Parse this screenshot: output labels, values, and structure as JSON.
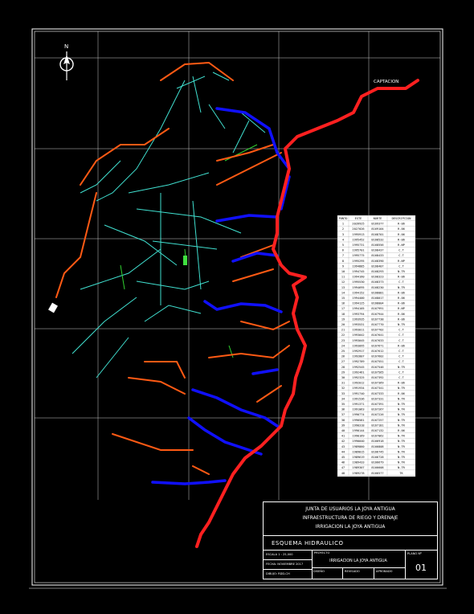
{
  "north_label": "N",
  "captacion_label": "CAPTACION",
  "table": {
    "headers": [
      "PUNTO",
      "ESTE",
      "NORTE",
      "DESCRIPCION"
    ],
    "rows": [
      [
        "1",
        "2026925",
        "8169377",
        "R-06"
      ],
      [
        "2",
        "2027026",
        "8169104",
        "R-06"
      ],
      [
        "3",
        "1995913",
        "8168701",
        "R-06"
      ],
      [
        "4",
        "1995452",
        "8168532",
        "R-06"
      ],
      [
        "5",
        "1995731",
        "8168556",
        "R-NP"
      ],
      [
        "6",
        "1995701",
        "8168437",
        "C.T"
      ],
      [
        "7",
        "1995775",
        "8168433",
        "C.T"
      ],
      [
        "8",
        "1995295",
        "8168390",
        "R-NP"
      ],
      [
        "9",
        "1994885",
        "8168407",
        "C.T"
      ],
      [
        "10",
        "1994745",
        "8168293",
        "N.TR"
      ],
      [
        "11",
        "1994160",
        "8168323",
        "R-06"
      ],
      [
        "12",
        "1995530",
        "8168373",
        "C.T"
      ],
      [
        "13",
        "1994695",
        "8168230",
        "N.TR"
      ],
      [
        "14",
        "1994152",
        "8168081",
        "R-06"
      ],
      [
        "15",
        "1994400",
        "8168017",
        "R-06"
      ],
      [
        "16",
        "1994125",
        "8168004",
        "R-06"
      ],
      [
        "17",
        "1994105",
        "8167991",
        "R-NP"
      ],
      [
        "18",
        "1993794",
        "8167944",
        "R-06"
      ],
      [
        "19",
        "1993935",
        "8167738",
        "R-06"
      ],
      [
        "20",
        "1993531",
        "8167770",
        "N.TR"
      ],
      [
        "21",
        "1993011",
        "8167702",
        "C.T"
      ],
      [
        "22",
        "1993042",
        "8167641",
        "C.T"
      ],
      [
        "23",
        "1993045",
        "8167633",
        "C.T"
      ],
      [
        "24",
        "1993095",
        "8167671",
        "R-06"
      ],
      [
        "25",
        "1992917",
        "8167612",
        "C.T"
      ],
      [
        "26",
        "1992807",
        "8167602",
        "C.T"
      ],
      [
        "27",
        "1992789",
        "8167551",
        "C.T"
      ],
      [
        "28",
        "1992545",
        "8167546",
        "N.TR"
      ],
      [
        "29",
        "1992461",
        "8167565",
        "C.T"
      ],
      [
        "30",
        "1992325",
        "8167392",
        "C.T"
      ],
      [
        "31",
        "1992012",
        "8167369",
        "R-06"
      ],
      [
        "32",
        "1991934",
        "8167341",
        "N.TR"
      ],
      [
        "33",
        "1991740",
        "8167333",
        "R-06"
      ],
      [
        "34",
        "1991536",
        "8167331",
        "N.TR"
      ],
      [
        "35",
        "1991371",
        "8167391",
        "N.TR"
      ],
      [
        "36",
        "1991063",
        "8167267",
        "N.TR"
      ],
      [
        "37",
        "1990774",
        "8167226",
        "N.TR"
      ],
      [
        "38",
        "1990581",
        "8167257",
        "N.TR"
      ],
      [
        "39",
        "1990318",
        "8167181",
        "N.TR"
      ],
      [
        "40",
        "1990144",
        "8167132",
        "R-06"
      ],
      [
        "41",
        "1990169",
        "8167062",
        "N.TR"
      ],
      [
        "42",
        "1990040",
        "8166918",
        "N.TR"
      ],
      [
        "43",
        "1989860",
        "8166808",
        "N.TR"
      ],
      [
        "44",
        "1989815",
        "8166745",
        "N.TR"
      ],
      [
        "45",
        "1989619",
        "8166728",
        "N.TR"
      ],
      [
        "46",
        "1989433",
        "8166679",
        "N.TR"
      ],
      [
        "47",
        "1989307",
        "8166608",
        "N.TR"
      ],
      [
        "48",
        "1989278",
        "8166577",
        "TK"
      ]
    ]
  },
  "title_block": {
    "org_line1": "JUNTA DE USUARIOS LA JOYA ANTIGUA",
    "org_line2": "INFRAESTRUCTURA DE RIEGO Y DRENAJE",
    "org_line3": "IRRIGACION LA JOYA ANTIGUA",
    "drawing_title": "ESQUEMA HIDRAULICO",
    "escala": "ESCALA 1 : 25,000",
    "fecha": "FECHA: NOVIEMBRE 2017",
    "dibujo": "DIBUJO: RDD-CH",
    "proyecto_label": "PROYECTO",
    "proyecto": "IRRIGACION LA JOYA ANTIGUA",
    "disenado_label": "DISEÑO",
    "revisado_label": "REVISADO",
    "aprobado_label": "APROBADO",
    "plano_label": "PLANO Nº",
    "plano_num": "01"
  },
  "colors": {
    "canal_principal": "#ff2020",
    "canal_lateral": "#ff5a14",
    "conduccion": "#1010ff",
    "distribucion": "#40e0d0",
    "grid": "#ffffff"
  }
}
